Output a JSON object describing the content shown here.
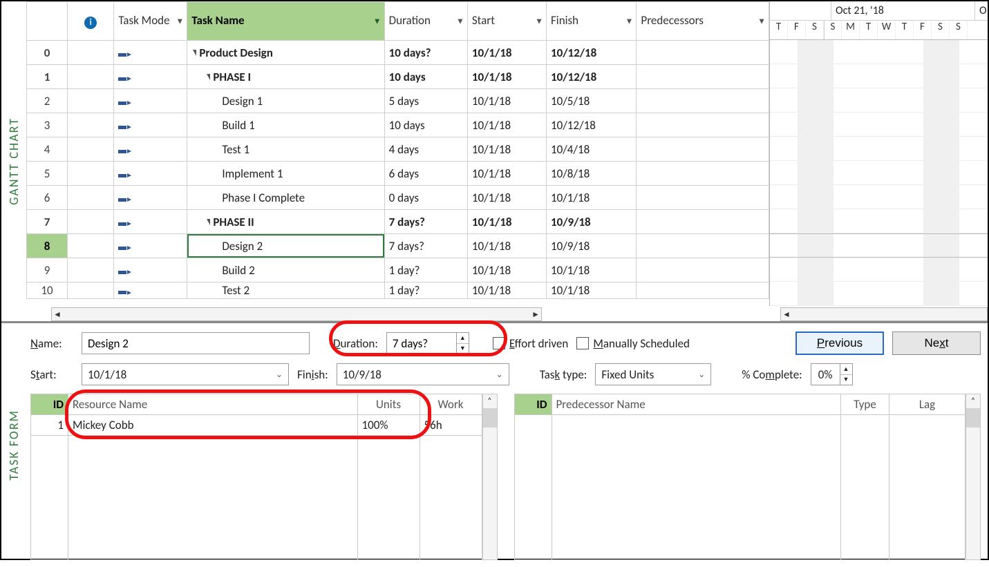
{
  "panes": {
    "gantt_label": "GANTT CHART",
    "taskform_label": "TASK FORM"
  },
  "columns": {
    "rownum": "",
    "info": "i",
    "mode": "Task Mode",
    "name": "Task Name",
    "duration": "Duration",
    "start": "Start",
    "finish": "Finish",
    "predecessors": "Predecessors"
  },
  "tasks": [
    {
      "n": "0",
      "name": "Product Design",
      "dur": "10 days?",
      "start": "10/1/18",
      "finish": "10/12/18",
      "indent": 0,
      "summary": true,
      "bold": true
    },
    {
      "n": "1",
      "name": "PHASE I",
      "dur": "10 days",
      "start": "10/1/18",
      "finish": "10/12/18",
      "indent": 1,
      "summary": true,
      "bold": true
    },
    {
      "n": "2",
      "name": "Design 1",
      "dur": "5 days",
      "start": "10/1/18",
      "finish": "10/5/18",
      "indent": 2,
      "summary": false,
      "bold": false
    },
    {
      "n": "3",
      "name": "Build 1",
      "dur": "10 days",
      "start": "10/1/18",
      "finish": "10/12/18",
      "indent": 2,
      "summary": false,
      "bold": false
    },
    {
      "n": "4",
      "name": "Test 1",
      "dur": "4 days",
      "start": "10/1/18",
      "finish": "10/4/18",
      "indent": 2,
      "summary": false,
      "bold": false
    },
    {
      "n": "5",
      "name": "Implement 1",
      "dur": "6 days",
      "start": "10/1/18",
      "finish": "10/8/18",
      "indent": 2,
      "summary": false,
      "bold": false
    },
    {
      "n": "6",
      "name": "Phase I Complete",
      "dur": "0 days",
      "start": "10/1/18",
      "finish": "10/1/18",
      "indent": 2,
      "summary": false,
      "bold": false
    },
    {
      "n": "7",
      "name": "PHASE II",
      "dur": "7 days?",
      "start": "10/1/18",
      "finish": "10/9/18",
      "indent": 1,
      "summary": true,
      "bold": true
    },
    {
      "n": "8",
      "name": "Design 2",
      "dur": "7 days?",
      "start": "10/1/18",
      "finish": "10/9/18",
      "indent": 2,
      "summary": false,
      "bold": false,
      "selected": true
    },
    {
      "n": "9",
      "name": "Build 2",
      "dur": "1 day?",
      "start": "10/1/18",
      "finish": "10/1/18",
      "indent": 2,
      "summary": false,
      "bold": false
    },
    {
      "n": "10",
      "name": "Test 2",
      "dur": "1 day?",
      "start": "10/1/18",
      "finish": "10/1/18",
      "indent": 2,
      "summary": false,
      "bold": false,
      "cut": true
    }
  ],
  "timeline": {
    "week_label": "Oct 21, '18",
    "next_week_prefix": "O",
    "days": [
      "T",
      "F",
      "S",
      "S",
      "M",
      "T",
      "W",
      "T",
      "F",
      "S",
      "S"
    ]
  },
  "form": {
    "name_label": "Name:",
    "name_value": "Design 2",
    "duration_label": "Duration:",
    "duration_value": "7 days?",
    "effort_label": "Effort driven",
    "manual_label": "Manually Scheduled",
    "previous_btn": "Previous",
    "next_btn": "Next",
    "start_label": "Start:",
    "start_value": "10/1/18",
    "finish_label": "Finish:",
    "finish_value": "10/9/18",
    "type_label": "Task type:",
    "type_value": "Fixed Units",
    "pct_label": "% Complete:",
    "pct_value": "0%"
  },
  "res_table": {
    "id": "ID",
    "name": "Resource Name",
    "units": "Units",
    "work": "Work",
    "rows": [
      {
        "id": "1",
        "name": "Mickey Cobb",
        "units": "100%",
        "work": "56h"
      }
    ]
  },
  "pred_table": {
    "id": "ID",
    "name": "Predecessor Name",
    "type": "Type",
    "lag": "Lag"
  }
}
